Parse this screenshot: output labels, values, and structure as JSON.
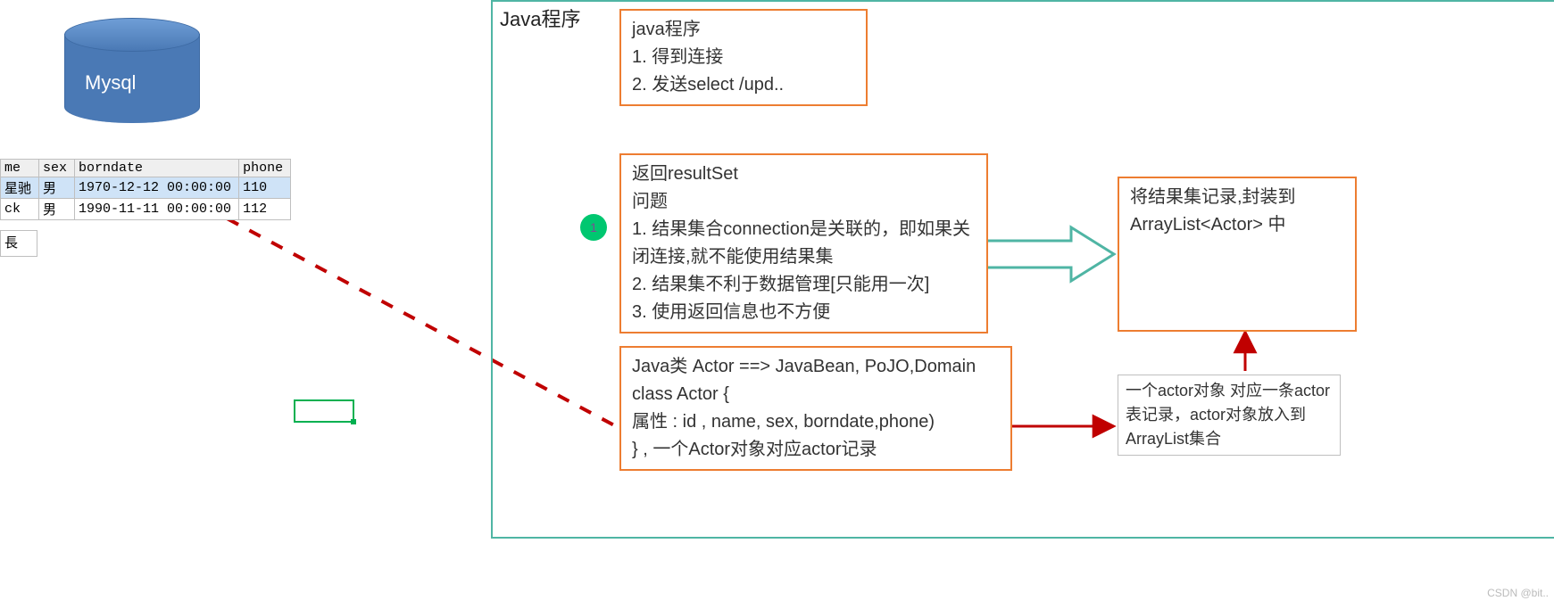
{
  "db": {
    "label": "Mysql"
  },
  "table": {
    "headers": [
      "me",
      "sex",
      "borndate",
      "phone"
    ],
    "rows": [
      {
        "name": "星驰",
        "sex": "男",
        "borndate": "1970-12-12 00:00:00",
        "phone": "110",
        "selected": true
      },
      {
        "name": "ck",
        "sex": "男",
        "borndate": "1990-11-11 00:00:00",
        "phone": "112",
        "selected": false
      }
    ]
  },
  "small_box_text": "長",
  "main_label": "Java程序",
  "box1": {
    "l1": "java程序",
    "l2": "1. 得到连接",
    "l3": "2. 发送select /upd.."
  },
  "box2": {
    "l1": "返回resultSet",
    "l2": "问题",
    "l3": "1. 结果集合connection是关联的，即如果关闭连接,就不能使用结果集",
    "l4": "2. 结果集不利于数据管理[只能用一次]",
    "l5": "3. 使用返回信息也不方便"
  },
  "box3": {
    "l1": "Java类 Actor  ==> JavaBean, PoJO,Domain",
    "l2": "class Actor {",
    "l3": "属性 : id , name, sex, borndate,phone)",
    "l4": "} , 一个Actor对象对应actor记录"
  },
  "box4": {
    "l1": "将结果集记录,封装到",
    "l2": "ArrayList<Actor> 中"
  },
  "gbox": {
    "l1": "一个actor对象 对应一条actor表记录，actor对象放入到ArrayList集合"
  },
  "circle": "1",
  "watermark": "CSDN @bit.."
}
